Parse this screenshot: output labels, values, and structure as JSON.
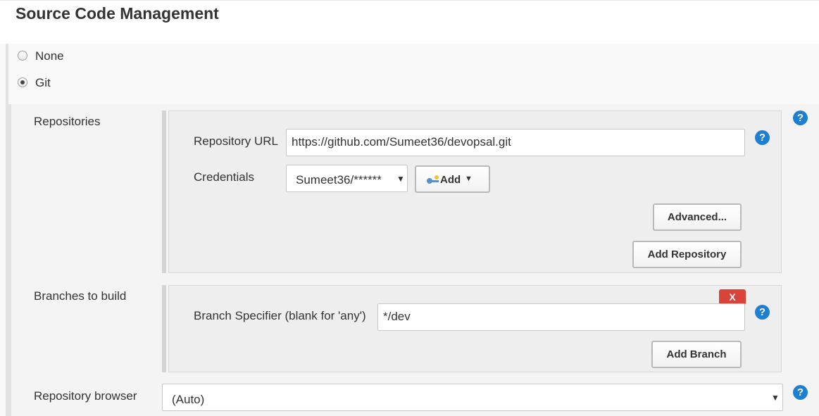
{
  "section": {
    "title": "Source Code Management"
  },
  "scm_options": [
    {
      "label": "None",
      "selected": false
    },
    {
      "label": "Git",
      "selected": true
    }
  ],
  "repositories": {
    "label": "Repositories",
    "url_label": "Repository URL",
    "url_value": "https://github.com/Sumeet36/devopsal.git",
    "credentials_label": "Credentials",
    "credentials_value": "Sumeet36/******",
    "add_button": "Add",
    "advanced_button": "Advanced...",
    "add_repository_button": "Add Repository"
  },
  "branches": {
    "label": "Branches to build",
    "delete_button": "X",
    "specifier_label": "Branch Specifier (blank for 'any')",
    "specifier_value": "*/dev",
    "add_branch_button": "Add Branch"
  },
  "repo_browser": {
    "label": "Repository browser",
    "value": "(Auto)"
  },
  "help_glyph": "?",
  "colors": {
    "help": "#1d7fd1",
    "delete": "#d9433a"
  }
}
